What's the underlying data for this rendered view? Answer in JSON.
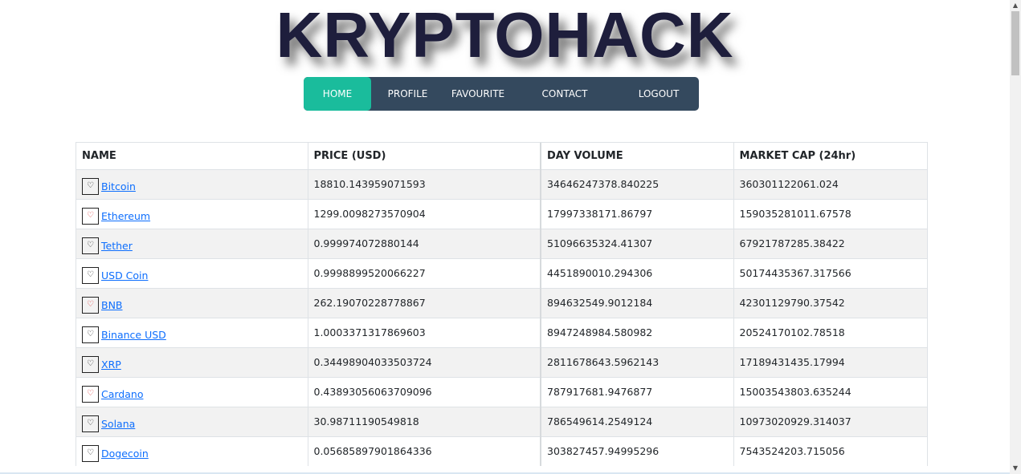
{
  "brand": {
    "title": "KRYPTOHACK"
  },
  "nav": {
    "items": [
      {
        "label": "HOME"
      },
      {
        "label": "PROFILE"
      },
      {
        "label": "FAVOURITE"
      },
      {
        "label": "CONTACT"
      },
      {
        "label": "LOGOUT"
      }
    ],
    "active": "HOME"
  },
  "table": {
    "headers": [
      "NAME",
      "PRICE (USD)",
      "DAY VOLUME",
      "MARKET CAP (24hr)"
    ],
    "rows": [
      {
        "name": "Bitcoin",
        "fav_icon": "♡",
        "favourited": false,
        "price": "18810.143959071593",
        "volume": "34646247378.840225",
        "market_cap": "360301122061.024"
      },
      {
        "name": "Ethereum",
        "fav_icon": "♡",
        "favourited": true,
        "price": "1299.0098273570904",
        "volume": "17997338171.86797",
        "market_cap": "159035281011.67578"
      },
      {
        "name": "Tether",
        "fav_icon": "♡",
        "favourited": false,
        "price": "0.999974072880144",
        "volume": "51096635324.41307",
        "market_cap": "67921787285.38422"
      },
      {
        "name": "USD Coin",
        "fav_icon": "♡",
        "favourited": false,
        "price": "0.9998899520066227",
        "volume": "4451890010.294306",
        "market_cap": "50174435367.317566"
      },
      {
        "name": "BNB",
        "fav_icon": "♡",
        "favourited": true,
        "price": "262.19070228778867",
        "volume": "894632549.9012184",
        "market_cap": "42301129790.37542"
      },
      {
        "name": "Binance USD",
        "fav_icon": "♡",
        "favourited": false,
        "price": "1.0003371317869603",
        "volume": "8947248984.580982",
        "market_cap": "20524170102.78518"
      },
      {
        "name": "XRP",
        "fav_icon": "♡",
        "favourited": false,
        "price": "0.34498904033503724",
        "volume": "2811678643.5962143",
        "market_cap": "17189431435.17994"
      },
      {
        "name": "Cardano",
        "fav_icon": "♡",
        "favourited": true,
        "price": "0.43893056063709096",
        "volume": "787917681.9476877",
        "market_cap": "15003543803.635244"
      },
      {
        "name": "Solana",
        "fav_icon": "♡",
        "favourited": false,
        "price": "30.98711190549818",
        "volume": "786549614.2549124",
        "market_cap": "10973020929.314037"
      },
      {
        "name": "Dogecoin",
        "fav_icon": "♡",
        "favourited": false,
        "price": "0.05685897901864336",
        "volume": "303827457.94995296",
        "market_cap": "7543524203.715056"
      }
    ]
  },
  "colors": {
    "nav_bg": "#34495e",
    "nav_active": "#1abc9c",
    "link": "#0d6efd",
    "fav_active": "#e03b3b",
    "row_stripe": "#f2f2f2"
  },
  "scrollbar": {
    "up_icon": "▲",
    "down_icon": "▼"
  }
}
